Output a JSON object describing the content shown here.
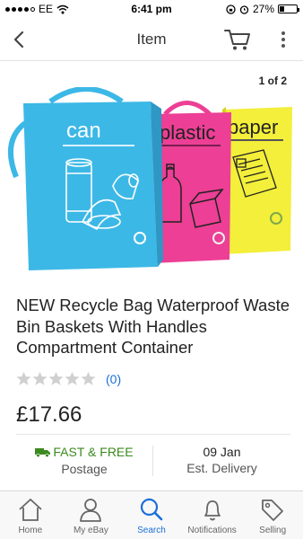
{
  "status_bar": {
    "carrier": "EE",
    "time": "6:41 pm",
    "battery": "27%",
    "battery_level": 0.27
  },
  "nav": {
    "title": "Item",
    "icons": [
      "back-arrow-icon",
      "cart-icon",
      "more-vertical-icon"
    ]
  },
  "gallery": {
    "page_indicator": "1 of 2",
    "bags": [
      {
        "label": "can",
        "color": "#3cb8e6"
      },
      {
        "label": "plastic",
        "color": "#ec3f95"
      },
      {
        "label": "paper",
        "color": "#f3ef3a"
      }
    ]
  },
  "product": {
    "title": "NEW Recycle Bag Waterproof Waste Bin Baskets With Handles Compartment Container",
    "rating_stars": 0,
    "review_count": "(0)",
    "price": "£17.66"
  },
  "shipping": {
    "shipping_label": "FAST & FREE",
    "shipping_sub": "Postage",
    "delivery_date": "09 Jan",
    "delivery_sub": "Est. Delivery"
  },
  "tabs": [
    {
      "label": "Home",
      "icon": "home-icon",
      "active": false
    },
    {
      "label": "My eBay",
      "icon": "person-icon",
      "active": false
    },
    {
      "label": "Search",
      "icon": "search-icon",
      "active": true
    },
    {
      "label": "Notifications",
      "icon": "bell-icon",
      "active": false
    },
    {
      "label": "Selling",
      "icon": "tag-icon",
      "active": false
    }
  ],
  "colors": {
    "accent": "#1a6fd8",
    "free_shipping": "#3c8a1f"
  }
}
